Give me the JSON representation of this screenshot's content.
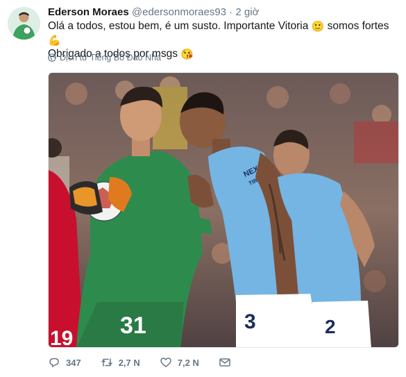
{
  "tweet": {
    "author_name": "Ederson Moraes",
    "handle": "@edersonmoraes93",
    "separator": "·",
    "time": "2 giờ",
    "line1": "Olá a todos, estou bem, é um susto. Importante Vitoria",
    "line1_tail": "somos fortes",
    "line2": "Obrigado a todos por msgs",
    "emoji_smile": "🙂",
    "emoji_muscle": "💪",
    "emoji_kiss": "😘",
    "translate_label": "Dịch từ Tiếng Bồ Đào Nha",
    "jersey_numbers": [
      "19",
      "31",
      "3",
      "2"
    ],
    "jersey_sponsor": "NEXEN",
    "jersey_sleeve": "TIRE"
  },
  "actions": {
    "reply_count": "347",
    "retweet_count": "2,7 N",
    "like_count": "7,2 N"
  },
  "colors": {
    "name": "#14171a",
    "secondary": "#657786",
    "city_blue": "#74b5e4",
    "keeper_green": "#2e8b4e",
    "liverpool_red": "#c8102e"
  },
  "icons": [
    "globe-icon",
    "reply-icon",
    "retweet-icon",
    "like-icon",
    "dm-icon"
  ]
}
